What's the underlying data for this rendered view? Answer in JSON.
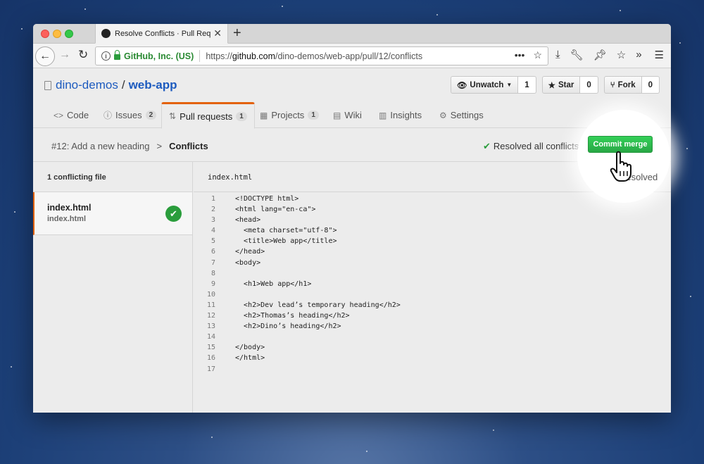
{
  "browser": {
    "tab_title": "Resolve Conflicts · Pull Request",
    "tab_close": "✕",
    "new_tab": "+",
    "cert_owner": "GitHub, Inc. (US)",
    "url_prefix": "https://",
    "url_host": "github.com",
    "url_path": "/dino-demos/web-app/pull/12/conflicts",
    "more_icon": "•••"
  },
  "repo": {
    "owner": "dino-demos",
    "separator": "/",
    "name": "web-app"
  },
  "actions": {
    "watch_label": "Unwatch",
    "watch_count": "1",
    "star_label": "Star",
    "star_count": "0",
    "fork_label": "Fork",
    "fork_count": "0"
  },
  "nav": {
    "code": "Code",
    "issues": "Issues",
    "issues_count": "2",
    "pulls": "Pull requests",
    "pulls_count": "1",
    "projects": "Projects",
    "projects_count": "1",
    "wiki": "Wiki",
    "insights": "Insights",
    "settings": "Settings"
  },
  "pr": {
    "title": "#12: Add a new heading",
    "crumb_sep": ">",
    "current": "Conflicts",
    "resolved_all": "Resolved all conflicts",
    "commit_label": "Commit merge"
  },
  "sidebar": {
    "header": "1 conflicting file",
    "file_name": "index.html",
    "file_path": "index.html"
  },
  "editor": {
    "file_name": "index.html",
    "resolved_label": "Resolved",
    "lines": [
      {
        "n": "1",
        "text": "<!DOCTYPE html>"
      },
      {
        "n": "2",
        "text": "<html lang=\"en-ca\">"
      },
      {
        "n": "3",
        "text": "<head>"
      },
      {
        "n": "4",
        "text": "  <meta charset=\"utf-8\">"
      },
      {
        "n": "5",
        "text": "  <title>Web app</title>"
      },
      {
        "n": "6",
        "text": "</head>"
      },
      {
        "n": "7",
        "text": "<body>"
      },
      {
        "n": "8",
        "text": ""
      },
      {
        "n": "9",
        "text": "  <h1>Web app</h1>"
      },
      {
        "n": "10",
        "text": ""
      },
      {
        "n": "11",
        "text": "  <h2>Dev lead’s temporary heading</h2>"
      },
      {
        "n": "12",
        "text": "  <h2>Thomas’s heading</h2>"
      },
      {
        "n": "13",
        "text": "  <h2>Dino’s heading</h2>"
      },
      {
        "n": "14",
        "text": ""
      },
      {
        "n": "15",
        "text": "</body>"
      },
      {
        "n": "16",
        "text": "</html>"
      },
      {
        "n": "17",
        "text": ""
      }
    ]
  }
}
